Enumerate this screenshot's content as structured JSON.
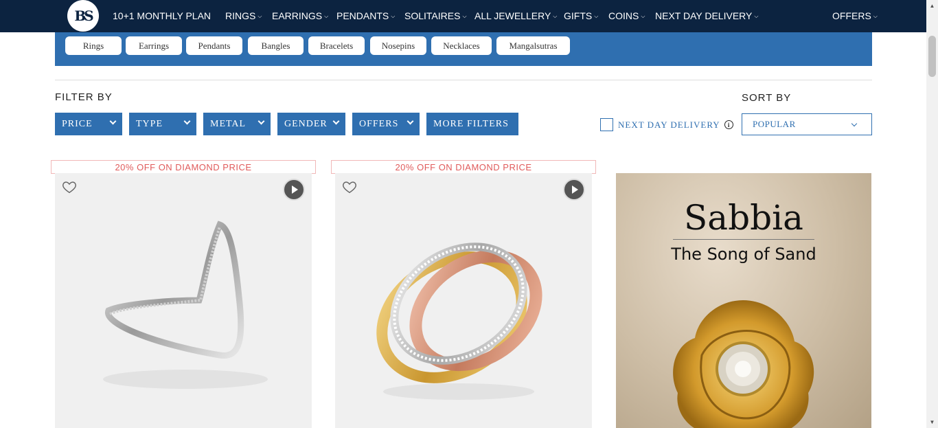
{
  "brand": {
    "logo_text": "BS"
  },
  "nav": {
    "items": [
      {
        "label": "10+1 MONTHLY PLAN",
        "has_menu": false
      },
      {
        "label": "RINGS",
        "has_menu": true
      },
      {
        "label": "EARRINGS",
        "has_menu": true
      },
      {
        "label": "PENDANTS",
        "has_menu": true
      },
      {
        "label": "SOLITAIRES",
        "has_menu": true
      },
      {
        "label": "ALL JEWELLERY",
        "has_menu": true
      },
      {
        "label": "GIFTS",
        "has_menu": true
      },
      {
        "label": "COINS",
        "has_menu": true
      },
      {
        "label": "NEXT DAY DELIVERY",
        "has_menu": true
      },
      {
        "label": "OFFERS",
        "has_menu": true
      }
    ]
  },
  "categories": [
    "Rings",
    "Earrings",
    "Pendants",
    "Bangles",
    "Bracelets",
    "Nosepins",
    "Necklaces",
    "Mangalsutras"
  ],
  "filters": {
    "title": "FILTER BY",
    "buttons": [
      "PRICE",
      "TYPE",
      "METAL",
      "GENDER",
      "OFFERS",
      "MORE FILTERS"
    ],
    "next_day_delivery": "NEXT DAY DELIVERY",
    "info_icon": "i"
  },
  "sort": {
    "title": "SORT BY",
    "selected": "POPULAR"
  },
  "products": [
    {
      "offer": "20% OFF ON DIAMOND PRICE",
      "image": "v-shaped diamond ring",
      "icons": [
        "heart-icon",
        "play-icon"
      ]
    },
    {
      "offer": "20% OFF ON DIAMOND PRICE",
      "image": "tri-tone rolling ring",
      "icons": [
        "heart-icon",
        "play-icon"
      ]
    }
  ],
  "promo": {
    "title": "Sabbia",
    "subtitle": "The Song of Sand"
  },
  "colors": {
    "nav_bg": "#0c2340",
    "accent": "#2f6fb0",
    "offer_text": "#e05a5a"
  }
}
